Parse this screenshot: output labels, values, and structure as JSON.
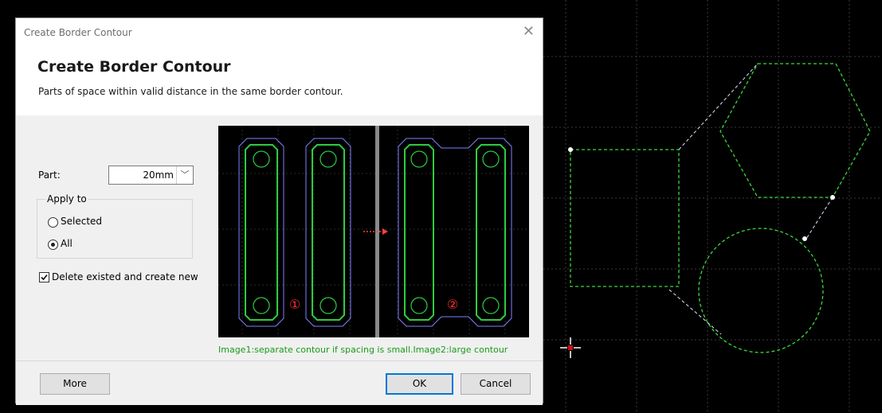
{
  "dialog": {
    "window_title": "Create Border Contour",
    "heading": "Create Border Contour",
    "description": "Parts of space within valid distance in the same border contour.",
    "part_label": "Part:",
    "part_value": "20mm",
    "apply_to": {
      "title": "Apply to",
      "options": [
        "Selected",
        "All"
      ],
      "selected": "All"
    },
    "delete_checkbox_label": "Delete existed and create new",
    "delete_checked": true,
    "preview_marker_1": "①",
    "preview_marker_2": "②",
    "caption": "Image1:separate contour if spacing is small.Image2:large contour",
    "buttons": {
      "more": "More",
      "ok": "OK",
      "cancel": "Cancel"
    }
  },
  "colors": {
    "canvas_bg": "#000000",
    "contour_green": "#2ecc40",
    "contour_purple": "#8080ff",
    "marker_red": "#ff3030",
    "caption_green": "#1a9a1a",
    "ok_border": "#0078d7"
  },
  "icons": [
    "close-icon",
    "chevron-down-icon",
    "checkmark-icon",
    "crosshair-cursor-icon"
  ]
}
